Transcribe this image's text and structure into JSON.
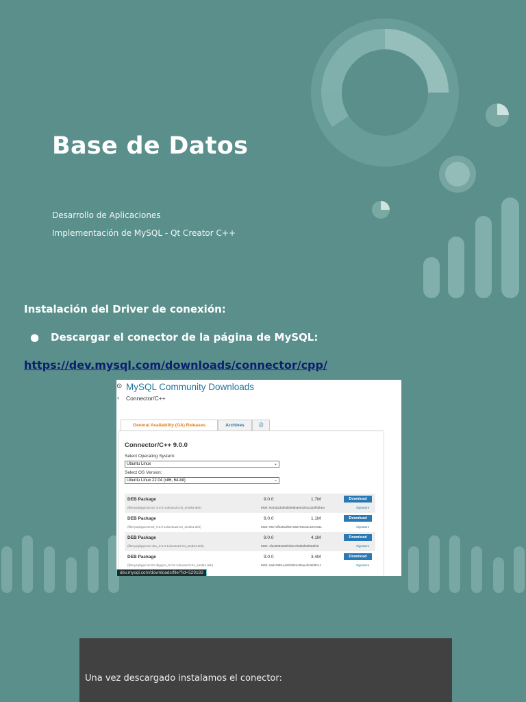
{
  "colors": {
    "background": "#5a8f8b",
    "decoration": "#8fbab6",
    "link": "#0b1f6e",
    "dark_box": "#414141",
    "download_button": "#2a79b4"
  },
  "cover": {
    "title": "Base de Datos",
    "subtitle_1": "Desarrollo de Aplicaciones",
    "subtitle_2": "Implementación de MySQL - Qt Creator C++"
  },
  "section": {
    "heading": "Instalación del Driver de conexión:",
    "bullet_symbol": "●",
    "bullet_text": "Descargar el conector de la página de MySQL:",
    "link": "https://dev.mysql.com/downloads/connector/cpp/"
  },
  "screenshot": {
    "header": "MySQL Community Downloads",
    "header_icon": "download-circle-icon",
    "subheader": "Connector/C++",
    "back_icon": "chevron-left-icon",
    "tabs": [
      "General Availability (GA) Releases",
      "Archives",
      "ⓘ"
    ],
    "panel_title": "Connector/C++ 9.0.0",
    "os_label": "Select Operating System:",
    "os_value": "Ubuntu Linux",
    "osver_label": "Select OS Version:",
    "osver_value": "Ubuntu Linux 22.04 (x86, 64-bit)",
    "download_label": "Download",
    "signature_label": "Signature",
    "packages": [
      {
        "name": "DEB Package",
        "file": "(libmysqlcppconn10_9.0.0-1ubuntu22.04_amd64.deb)",
        "version": "9.0.0",
        "size": "1.7M",
        "md5": "MD5: 9c83a23bb0d5066ba0e3291a110f92bea"
      },
      {
        "name": "DEB Package",
        "file": "(libmysqlcppconnx2_9.0.0-1ubuntu22.04_amd64.deb)",
        "version": "9.0.0",
        "size": "1.1M",
        "md5": "MD5: 96e7df43563f587a6a786c82c29ec8a1"
      },
      {
        "name": "DEB Package",
        "file": "(libmysqlcppconn-dev_9.0.0-1ubuntu22.04_amd64.deb)",
        "version": "9.0.0",
        "size": "4.1M",
        "md5": "MD5: 1fae98d3225f4bbcef6d65f69f658f29"
      },
      {
        "name": "DEB Package",
        "file": "(libmysqlcppconn10-dbgsym_9.0.0-1ubuntu22.04_amd64.deb)",
        "version": "9.0.0",
        "size": "3.4M",
        "md5": "MD5: 6a6109b1a462fa924c8bae4fc86f8214"
      }
    ],
    "status_url": "dev.mysql.com/downloads/file/?id=529183"
  },
  "footer_box": {
    "text": "Una vez descargado instalamos el conector:"
  }
}
